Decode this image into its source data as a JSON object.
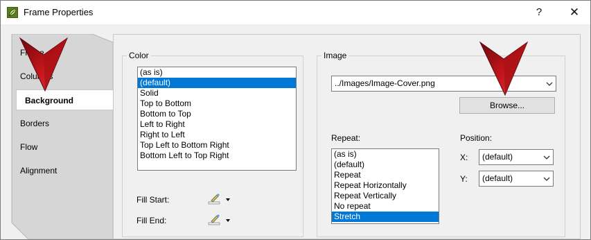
{
  "window": {
    "title": "Frame Properties",
    "help_glyph": "?",
    "close_glyph": "✕"
  },
  "tabs": [
    {
      "label": "Frame"
    },
    {
      "label": "Columns"
    },
    {
      "label": "Background"
    },
    {
      "label": "Borders"
    },
    {
      "label": "Flow"
    },
    {
      "label": "Alignment"
    }
  ],
  "color_group": {
    "label": "Color",
    "items": [
      "(as is)",
      "(default)",
      "Solid",
      "Top to Bottom",
      "Bottom to Top",
      "Left to Right",
      "Right to Left",
      "Top Left to Bottom Right",
      "Bottom Left to Top Right"
    ],
    "selected": "(default)",
    "fill_start_label": "Fill Start:",
    "fill_end_label": "Fill End:"
  },
  "image_group": {
    "label": "Image",
    "path_value": "../Images/Image-Cover.png",
    "browse_label": "Browse...",
    "repeat_label": "Repeat:",
    "repeat_items": [
      "(as is)",
      "(default)",
      "Repeat",
      "Repeat Horizontally",
      "Repeat Vertically",
      "No repeat",
      "Stretch"
    ],
    "repeat_selected": "Stretch",
    "position_label": "Position:",
    "x_label": "X:",
    "x_value": "(default)",
    "y_label": "Y:",
    "y_value": "(default)"
  },
  "colors": {
    "selection": "#0078d7",
    "annotation_arrow": "#c0141a"
  },
  "icons": {
    "app": "leaf-icon",
    "picker": "brush-picker-icon",
    "dropdown": "chevron-down-icon"
  }
}
